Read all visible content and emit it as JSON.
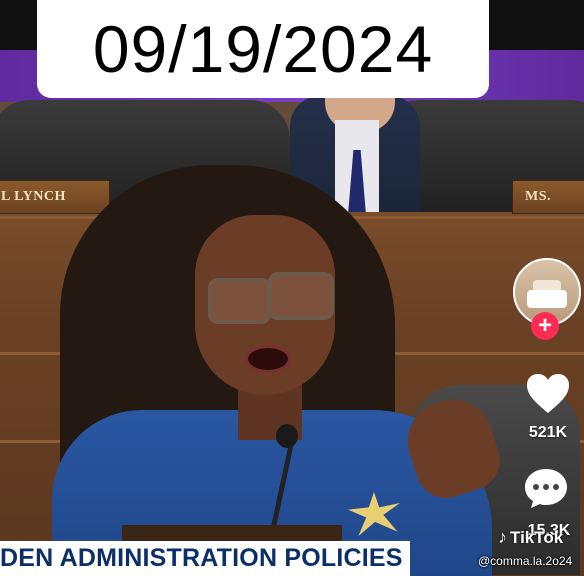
{
  "overlay": {
    "date": "09/19/2024",
    "chyron": "DEN ADMINISTRATION POLICIES"
  },
  "nameplates": {
    "left": "L LYNCH",
    "right": "MS."
  },
  "rail": {
    "likes": "521K",
    "comments": "15.3K",
    "follow_glyph": "+",
    "icons": [
      "avatar",
      "follow-plus-icon",
      "heart-icon",
      "comment-icon",
      "tiktok-logo-icon"
    ]
  },
  "brand": {
    "name": "TikTok",
    "handle": "@comma.la.2o24",
    "accent": "#fe2c55"
  }
}
